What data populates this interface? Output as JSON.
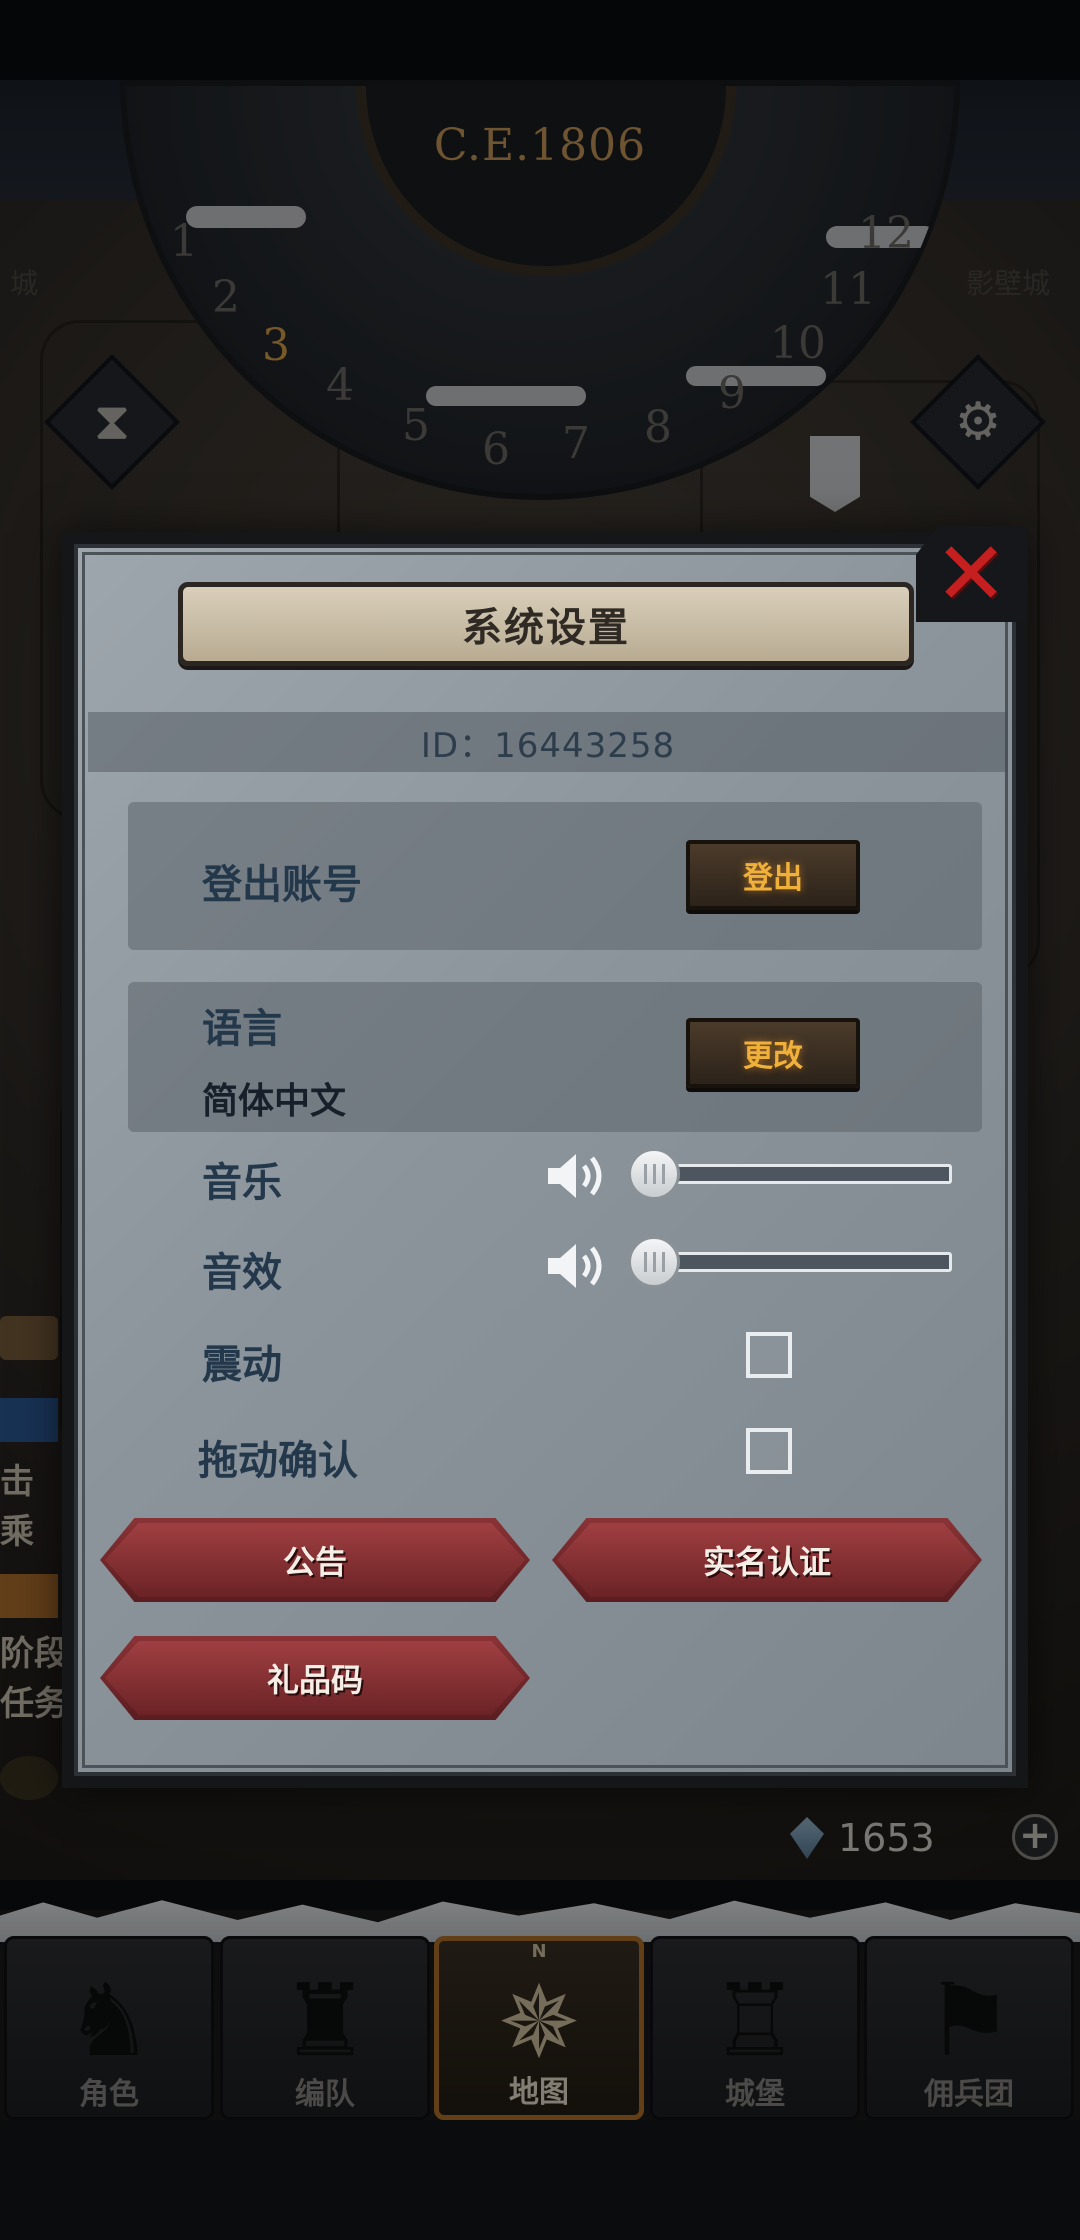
{
  "game": {
    "year": "C.E.1806",
    "dial_numbers": [
      "1",
      "2",
      "3",
      "4",
      "5",
      "6",
      "7",
      "8",
      "9",
      "10",
      "11",
      "12"
    ],
    "active_number": "3",
    "far_label_left": "城",
    "far_label_right": "影壁城",
    "side_items": [
      "击",
      "乘",
      "阶段",
      "任务"
    ],
    "diamond_count": "1653",
    "plus_symbol": "+"
  },
  "modal": {
    "title": "系统设置",
    "id_text": "ID：16443258",
    "logout": {
      "label": "登出账号",
      "button": "登出"
    },
    "language": {
      "label": "语言",
      "value": "简体中文",
      "button": "更改"
    },
    "music": {
      "label": "音乐",
      "level": 0
    },
    "sound": {
      "label": "音效",
      "level": 0
    },
    "vibration": {
      "label": "震动",
      "checked": false
    },
    "drag_confirm": {
      "label": "拖动确认",
      "checked": false
    },
    "buttons": {
      "announcement": "公告",
      "real_name": "实名认证",
      "gift_code": "礼品码"
    },
    "close_symbol": "✕"
  },
  "nav": {
    "compass_mark": "N",
    "tabs": [
      {
        "label": "角色",
        "icon": "knight-icon"
      },
      {
        "label": "编队",
        "icon": "helmet-icon"
      },
      {
        "label": "地图",
        "icon": "compass-icon",
        "active": true
      },
      {
        "label": "城堡",
        "icon": "castle-icon"
      },
      {
        "label": "佣兵团",
        "icon": "banner-icon"
      }
    ]
  },
  "colors": {
    "accent_gold": "#f0b13b",
    "close_red": "#c51f1f",
    "button_red": "#8a3336"
  }
}
